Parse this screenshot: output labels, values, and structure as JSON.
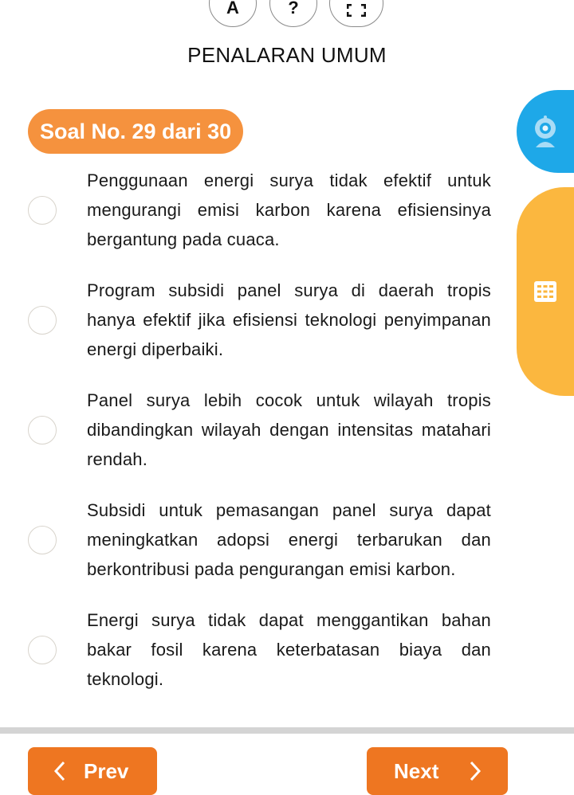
{
  "toolbar": {
    "font_button_label": "A",
    "help_button_label": "?",
    "fullscreen_icon": "fullscreen-icon"
  },
  "header": {
    "title": "PENALARAN UMUM"
  },
  "question": {
    "badge": "Soal No. 29 dari 30"
  },
  "side_tabs": {
    "camera_icon": "webcam-icon",
    "grid_icon": "grid-icon"
  },
  "options": [
    {
      "text": "Penggunaan energi surya tidak efektif untuk mengurangi emisi karbon karena efisiensinya bergantung pada cuaca.",
      "selected": false
    },
    {
      "text": "Program subsidi panel surya di daerah tropis hanya efektif jika efisiensi teknologi penyimpanan energi diperbaiki.",
      "selected": false
    },
    {
      "text": "Panel surya lebih cocok untuk wilayah tropis dibandingkan wilayah dengan intensitas matahari rendah.",
      "selected": false
    },
    {
      "text": "Subsidi untuk pemasangan panel surya dapat meningkatkan adopsi energi terbarukan dan berkontribusi pada pengurangan emisi karbon.",
      "selected": false
    },
    {
      "text": "Energi surya tidak dapat menggantikan bahan bakar fosil karena keterbatasan biaya dan teknologi.",
      "selected": false
    }
  ],
  "navigation": {
    "prev_label": "Prev",
    "next_label": "Next"
  },
  "colors": {
    "badge": "#f5923e",
    "camera_tab": "#1ea8e8",
    "grid_tab": "#fbb73f",
    "nav_button": "#ee7621"
  }
}
